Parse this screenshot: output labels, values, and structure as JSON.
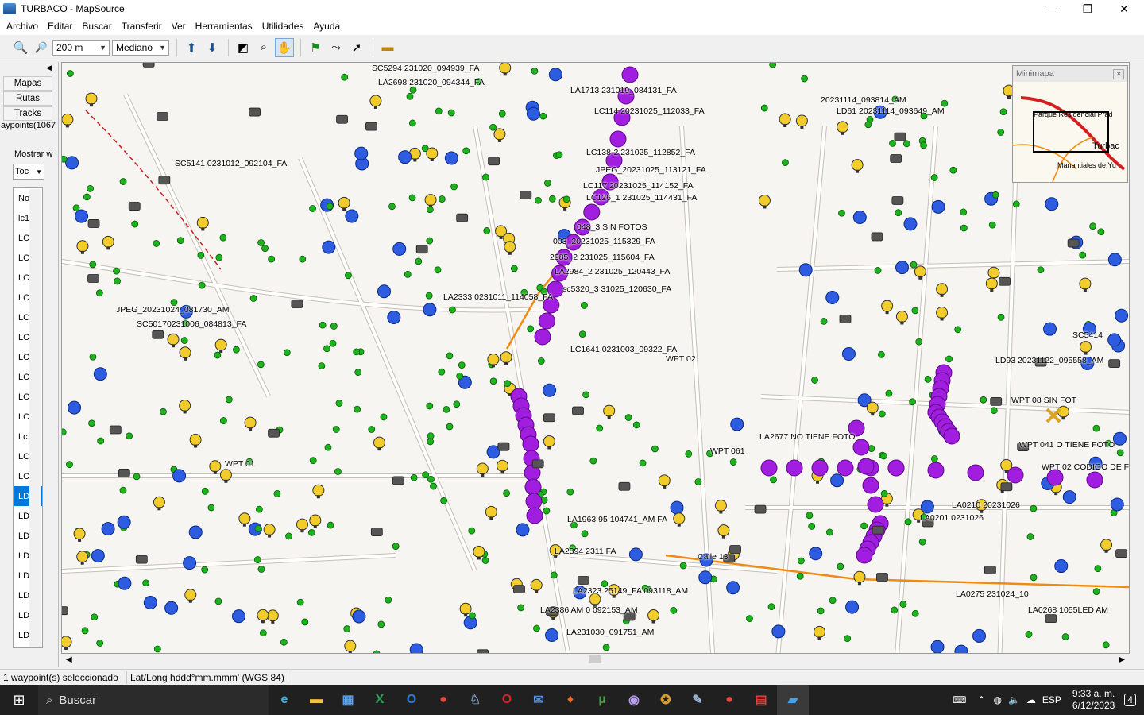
{
  "window": {
    "title": "TURBACO - MapSource",
    "minimize": "—",
    "restore": "❐",
    "close": "✕"
  },
  "menu": [
    "Archivo",
    "Editar",
    "Buscar",
    "Transferir",
    "Ver",
    "Herramientas",
    "Utilidades",
    "Ayuda"
  ],
  "toolbar": {
    "zoom_in_icon": "zoom-in-icon",
    "zoom_out_icon": "zoom-out-icon",
    "scale_value": "200 m",
    "detail_value": "Mediano"
  },
  "left_panel": {
    "tabs": [
      "Mapas",
      "Rutas",
      "Tracks"
    ],
    "waypoints_tab": "aypoints(1067",
    "show_label": "Mostrar w",
    "filter_value": "Toc",
    "list": [
      "No",
      "lc1",
      "LC",
      "LC",
      "LC",
      "LC",
      "LC",
      "LC",
      "LC",
      "LC",
      "LC",
      "LC",
      "Lc",
      "LC",
      "LC",
      "LD",
      "LD",
      "LD",
      "LD",
      "LD",
      "LD",
      "LD",
      "LD",
      "LD"
    ],
    "selected_index": 15
  },
  "map": {
    "labels": [
      {
        "t": "SC5294 231020_094939_FA"
      },
      {
        "t": "LA2698 231020_094344_FA"
      },
      {
        "t": "LA1713 231019_084131_FA"
      },
      {
        "t": "LC114 20231025_112033_FA"
      },
      {
        "t": "LC126_1 231025_114431_FA"
      },
      {
        "t": "SC5141 0231012_092104_FA"
      },
      {
        "t": "LC138-2 231025_112852_FA"
      },
      {
        "t": "JPEG_20231025_113121_FA"
      },
      {
        "t": "LC117 20231025_114152_FA"
      },
      {
        "t": "048_3 SIN FOTOS"
      },
      {
        "t": "003_20231025_115329_FA"
      },
      {
        "t": "2985_2 231025_115604_FA"
      },
      {
        "t": "LA2984_2 231025_120443_FA"
      },
      {
        "t": "sc5320_3 31025_120630_FA"
      },
      {
        "t": "LC1641 0231003_09322_FA"
      },
      {
        "t": "WPT 02"
      },
      {
        "t": "LA2677 NO TIENE FOTO"
      },
      {
        "t": "WPT 061"
      },
      {
        "t": "WPT 041 O TIENE FOTO"
      },
      {
        "t": "WPT 02 CODIGO DE F"
      },
      {
        "t": "JPEG_20231024_081730_AM"
      },
      {
        "t": "SC50170231006_084813_FA"
      },
      {
        "t": "LA2333 0231011_114058_FA"
      },
      {
        "t": "WPT 01"
      },
      {
        "t": "LA1963 95 104741_AM FA"
      },
      {
        "t": "LA2394 2311 FA"
      },
      {
        "t": "LA2323 25149_FA 093118_AM"
      },
      {
        "t": "LA2386 AM 0 092153_AM"
      },
      {
        "t": "LA231030_091751_AM"
      },
      {
        "t": "Calle 13"
      },
      {
        "t": "Parque Residencial Prad"
      },
      {
        "t": "20231114_093814_AM"
      },
      {
        "t": "LD61 20231114_093649_AM"
      },
      {
        "t": "LD93 20231122_095558_AM"
      },
      {
        "t": "WPT 08 SIN FOT"
      },
      {
        "t": "LA0201 0231026"
      },
      {
        "t": "LA0210 20231026"
      },
      {
        "t": "LA0275 231024_10"
      },
      {
        "t": "LA0268 1055LED AM"
      },
      {
        "t": "SC5414"
      }
    ]
  },
  "minimap": {
    "title": "Minimapa",
    "close": "✕",
    "labels": [
      "Parque Residencial Prad",
      "Turbac",
      "Manantiales de Yu"
    ]
  },
  "status": {
    "selection": "1 waypoint(s) seleccionado",
    "coord_format": "Lat/Long hddd°mm.mmm' (WGS 84)"
  },
  "taskbar": {
    "search": "Buscar",
    "language": "ESP",
    "time": "9:33 a. m.",
    "date": "6/12/2023",
    "notifications": "4"
  },
  "colors": {
    "waypoint_green": "#1db31d",
    "waypoint_yellow": "#f2cc2a",
    "waypoint_blue": "#2d5ce0",
    "waypoint_purple": "#a11ee0",
    "road_orange": "#f08a10",
    "road_red": "#d02020"
  }
}
